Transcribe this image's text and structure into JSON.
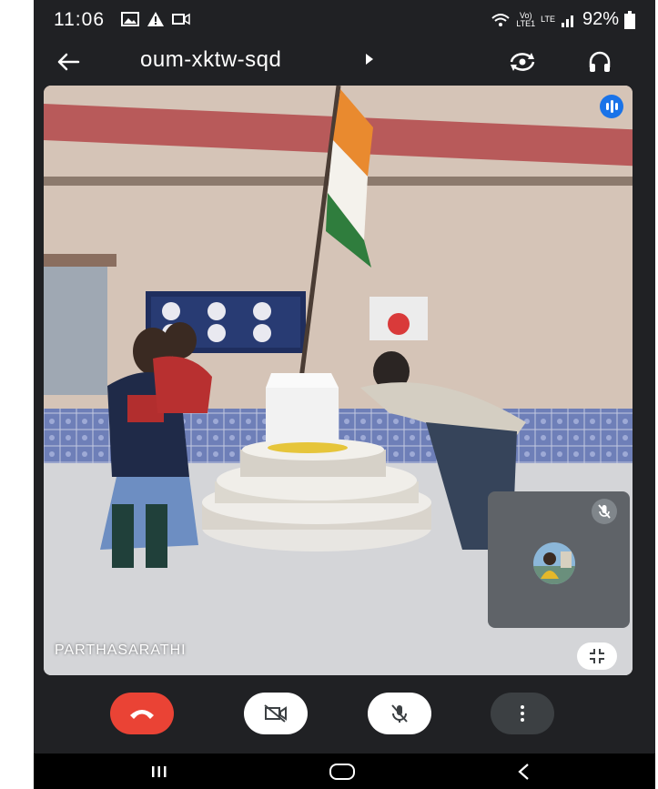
{
  "status_bar": {
    "time": "11:06",
    "network_top": "Vo)",
    "network_bottom": "LTE1",
    "lte": "LTE",
    "battery": "92%"
  },
  "header": {
    "meeting_code": "oum-xktw-sqd"
  },
  "video": {
    "participant_name": "PARTHASARATHI"
  },
  "icons": {
    "back": "arrow-left-icon",
    "switch_camera": "switch-camera-icon",
    "audio": "headphones-icon",
    "speaking": "audio-level-icon",
    "self_mic": "mic-off-icon",
    "minimize": "minimize-icon",
    "end_call": "phone-hangup-icon",
    "camera": "camera-off-icon",
    "mic": "mic-off-icon",
    "more": "more-vert-icon"
  },
  "colors": {
    "end_call": "#ea4335",
    "speaking": "#1a73e8",
    "background": "#202124"
  }
}
